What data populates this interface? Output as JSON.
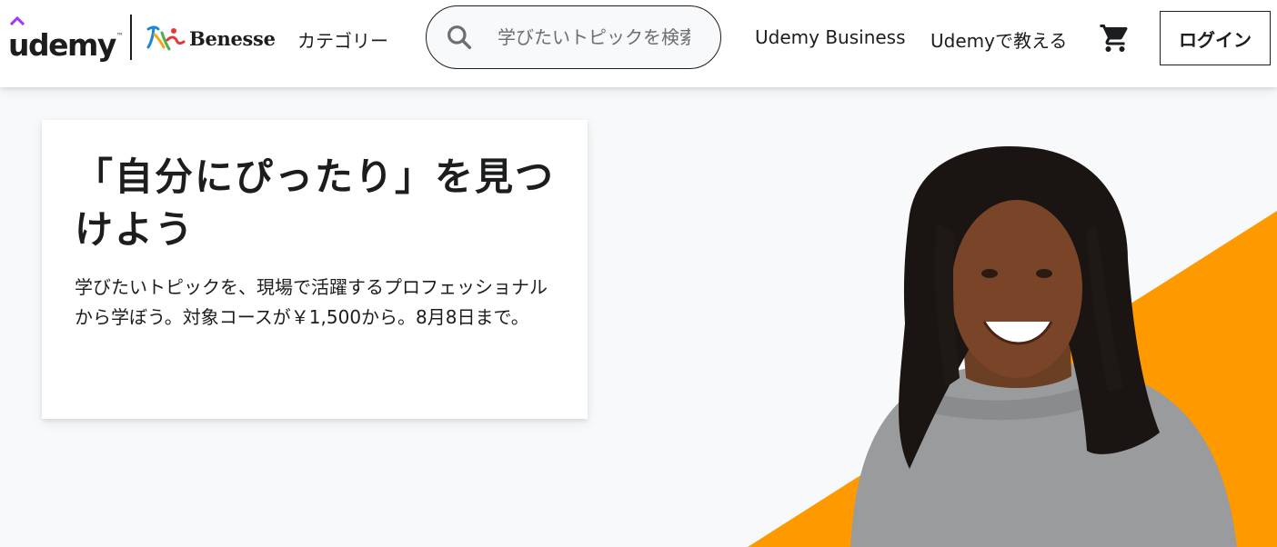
{
  "header": {
    "logo": {
      "udemy_text": "udemy",
      "udemy_tm": "™",
      "partner_text": "Benesse"
    },
    "categories_label": "カテゴリー",
    "search": {
      "placeholder": "学びたいトピックを検索",
      "value": "",
      "icon": "search-icon"
    },
    "nav": {
      "business_label": "Udemy Business",
      "teach_label": "Udemyで教える"
    },
    "cart_icon": "cart-icon",
    "login_label": "ログイン"
  },
  "hero": {
    "title": "「自分にぴったり」を見つけよう",
    "description": "学びたいトピックを、現場で活躍するプロフェッショナルから学ぼう。対象コースが￥1,500から。8月8日まで。",
    "image": "instructor-portrait"
  },
  "colors": {
    "brand_purple": "#a435f0",
    "accent_orange": "#ff9900",
    "text": "#1c1d1f",
    "background": "#f7f9fa"
  }
}
